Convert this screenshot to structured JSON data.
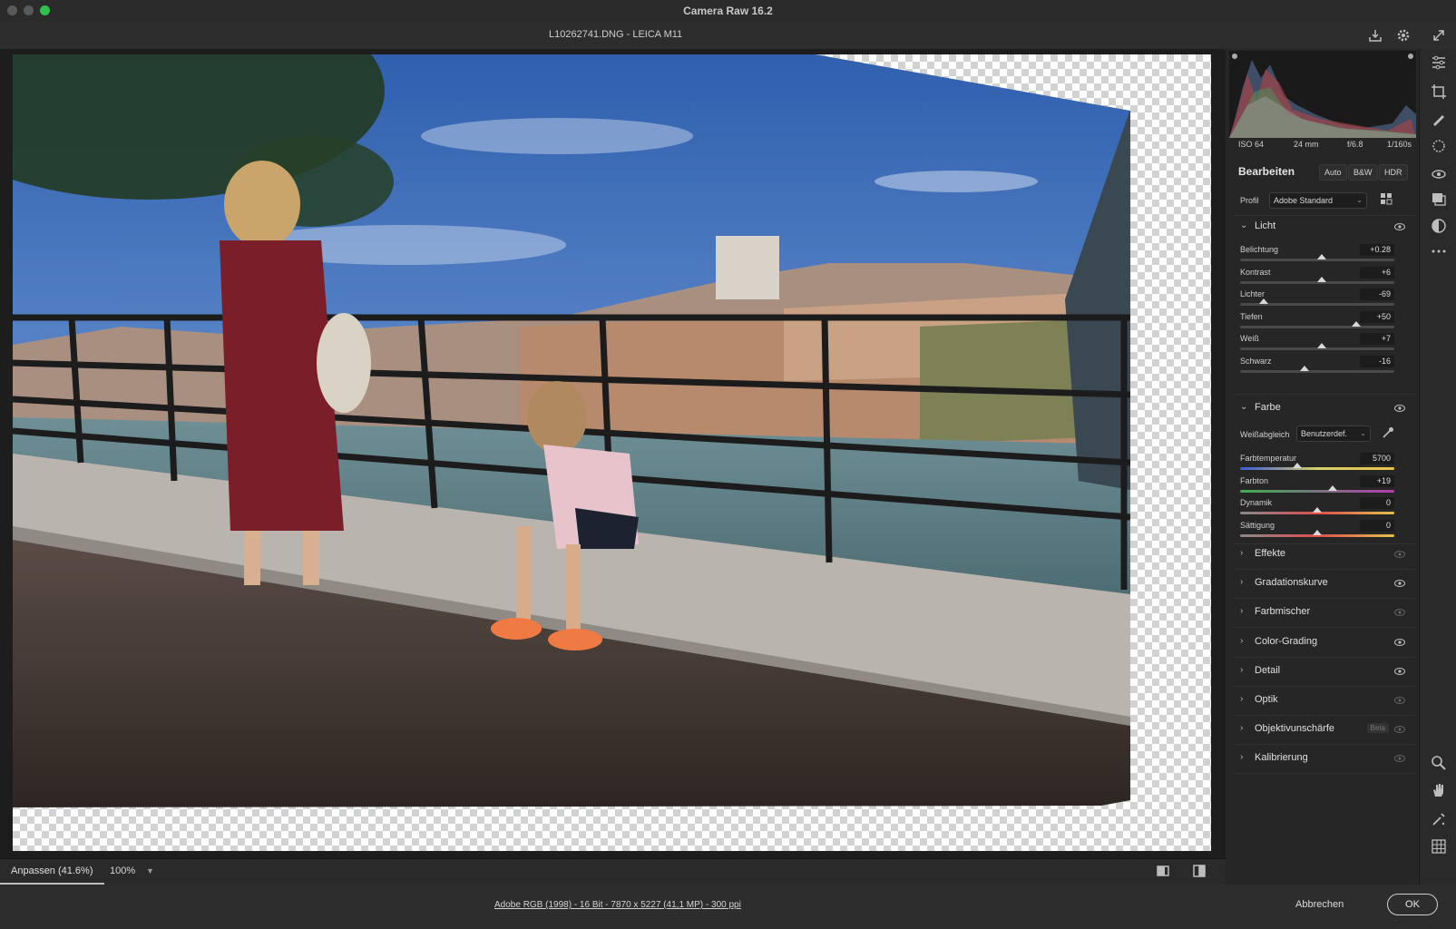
{
  "window": {
    "title": "Camera Raw 16.2"
  },
  "file": {
    "name": "L10262741.DNG  -  LEICA M11"
  },
  "zoom": {
    "fit_label": "Anpassen (41.6%)",
    "level": "100%"
  },
  "footer": {
    "info": "Adobe RGB (1998) - 16 Bit - 7870 x 5227 (41,1 MP) - 300 ppi",
    "cancel": "Abbrechen",
    "ok": "OK"
  },
  "exif": {
    "iso": "ISO 64",
    "focal": "24 mm",
    "aperture": "f/6.8",
    "shutter": "1/160s"
  },
  "edit": {
    "title": "Bearbeiten",
    "auto": "Auto",
    "bw": "B&W",
    "hdr": "HDR",
    "profile_label": "Profil",
    "profile_value": "Adobe Standard"
  },
  "light": {
    "title": "Licht",
    "sliders": [
      {
        "label": "Belichtung",
        "value": "+0.28",
        "pos": 0.53
      },
      {
        "label": "Kontrast",
        "value": "+6",
        "pos": 0.53
      },
      {
        "label": "Lichter",
        "value": "-69",
        "pos": 0.15
      },
      {
        "label": "Tiefen",
        "value": "+50",
        "pos": 0.75
      },
      {
        "label": "Weiß",
        "value": "+7",
        "pos": 0.53
      },
      {
        "label": "Schwarz",
        "value": "-16",
        "pos": 0.42
      }
    ]
  },
  "color": {
    "title": "Farbe",
    "wb_label": "Weißabgleich",
    "wb_value": "Benutzerdef.",
    "sliders": [
      {
        "label": "Farbtemperatur",
        "value": "5700",
        "pos": 0.37
      },
      {
        "label": "Farbton",
        "value": "+19",
        "pos": 0.6
      },
      {
        "label": "Dynamik",
        "value": "0",
        "pos": 0.5
      },
      {
        "label": "Sättigung",
        "value": "0",
        "pos": 0.5
      }
    ]
  },
  "groups": [
    "Effekte",
    "Gradationskurve",
    "Farbmischer",
    "Color-Grading",
    "Detail",
    "Optik",
    "Objektivunschärfe",
    "Kalibrierung"
  ],
  "beta_badge": "Beta"
}
